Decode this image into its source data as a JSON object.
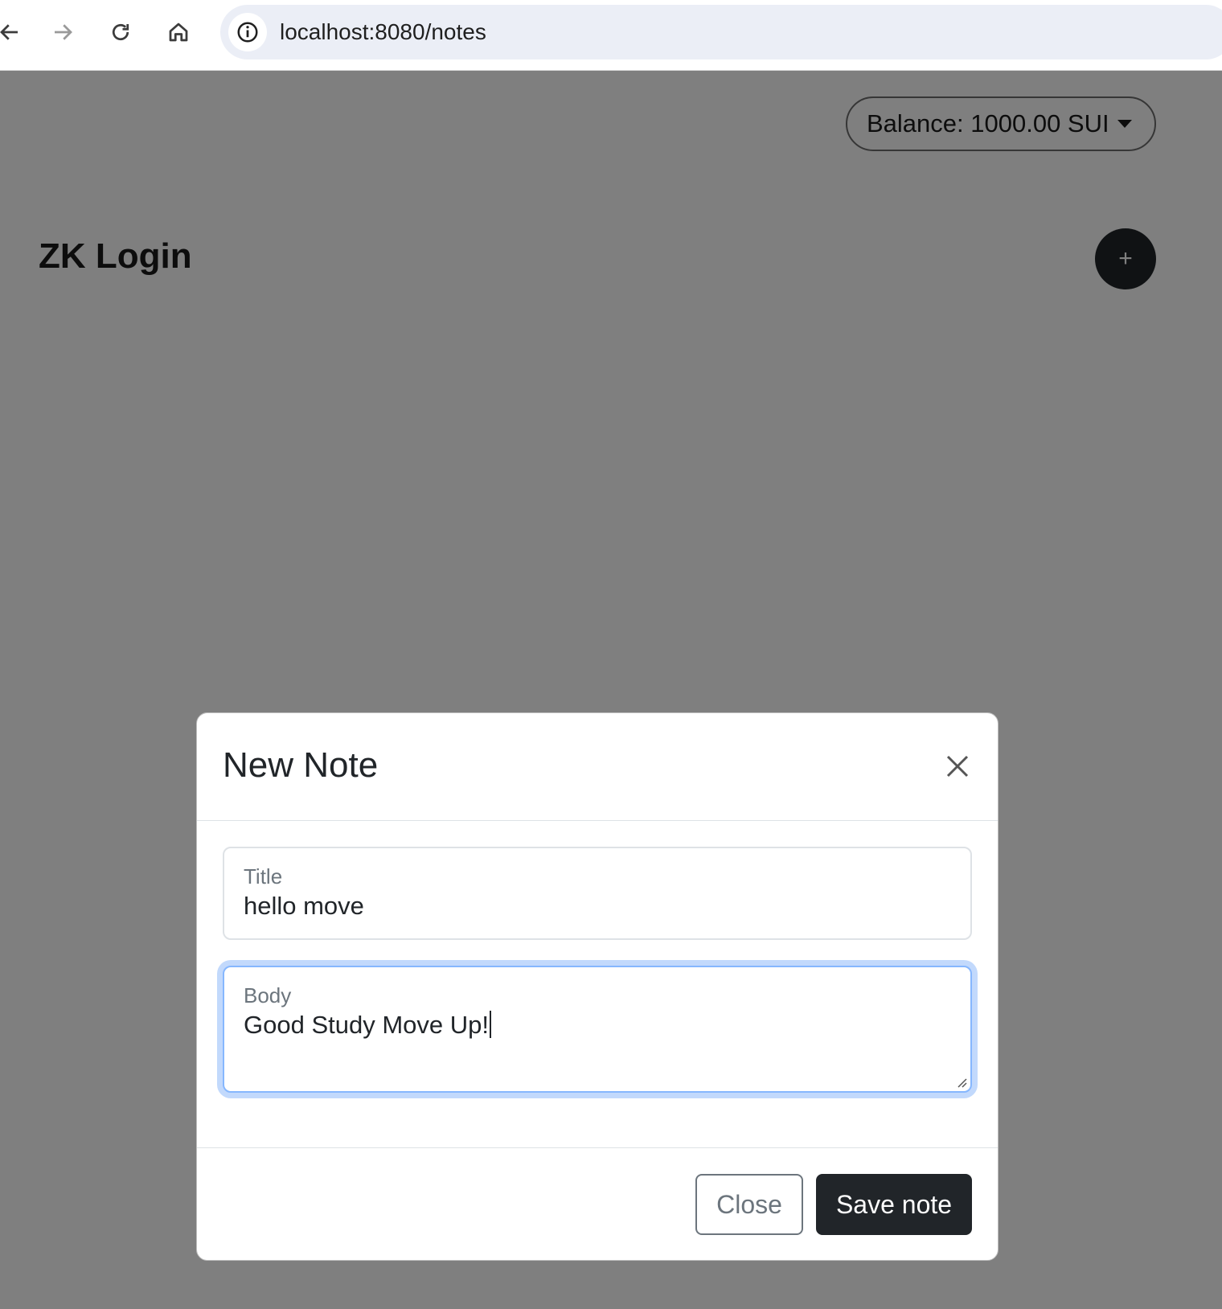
{
  "browser": {
    "url": "localhost:8080/notes",
    "icons": [
      "back-arrow-icon",
      "forward-arrow-icon",
      "reload-icon",
      "home-icon",
      "info-icon"
    ]
  },
  "header": {
    "balance_label": "Balance: 1000.00 SUI"
  },
  "page": {
    "title": "ZK Login",
    "add_button_label": "+"
  },
  "modal": {
    "title": "New Note",
    "fields": {
      "title": {
        "label": "Title",
        "value": "hello move"
      },
      "body": {
        "label": "Body",
        "value": "Good Study Move Up!"
      }
    },
    "buttons": {
      "close_label": "Close",
      "save_label": "Save note"
    }
  },
  "colors": {
    "primary_dark": "#212529",
    "focus_ring": "#86b7fe",
    "backdrop": "#808080"
  }
}
